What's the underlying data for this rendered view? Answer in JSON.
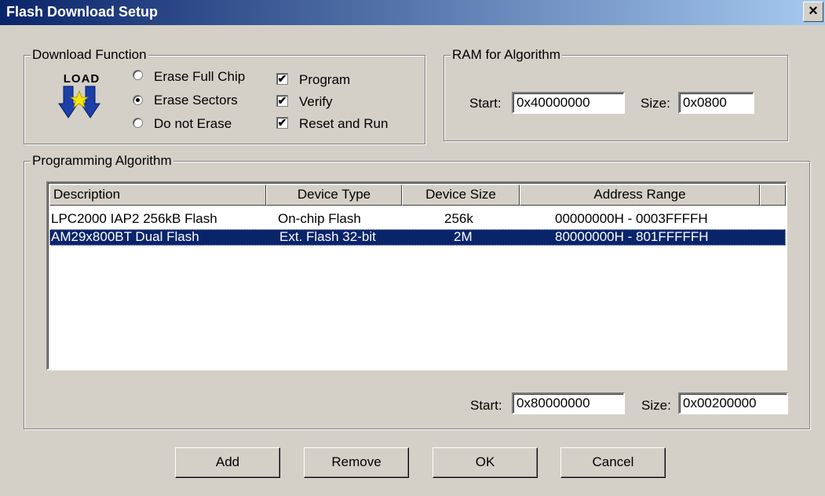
{
  "window": {
    "title": "Flash Download Setup",
    "close_glyph": "×"
  },
  "download_function": {
    "legend": "Download Function",
    "icon_text": "LOAD",
    "radios": [
      {
        "label": "Erase Full Chip",
        "selected": false
      },
      {
        "label": "Erase Sectors",
        "selected": true
      },
      {
        "label": "Do not Erase",
        "selected": false
      }
    ],
    "checks": [
      {
        "label": "Program",
        "checked": true,
        "mark": "✔"
      },
      {
        "label": "Verify",
        "checked": true,
        "mark": "✔"
      },
      {
        "label": "Reset and Run",
        "checked": true,
        "mark": "✔"
      }
    ]
  },
  "ram": {
    "legend": "RAM for Algorithm",
    "start_label": "Start:",
    "start_value": "0x40000000",
    "size_label": "Size:",
    "size_value": "0x0800"
  },
  "programming": {
    "legend": "Programming Algorithm",
    "columns": [
      "Description",
      "Device Type",
      "Device Size",
      "Address Range"
    ],
    "rows": [
      {
        "description": "LPC2000 IAP2 256kB Flash",
        "device_type": "On-chip Flash",
        "device_size": "256k",
        "address_range": "00000000H - 0003FFFFH",
        "selected": false
      },
      {
        "description": "AM29x800BT Dual Flash",
        "device_type": "Ext. Flash 32-bit",
        "device_size": "2M",
        "address_range": "80000000H - 801FFFFFH",
        "selected": true
      }
    ],
    "start_label": "Start:",
    "start_value": "0x80000000",
    "size_label": "Size:",
    "size_value": "0x00200000"
  },
  "buttons": {
    "add": "Add",
    "remove": "Remove",
    "ok": "OK",
    "cancel": "Cancel"
  },
  "colors": {
    "dialog_face": "#d4d0c8",
    "title_active": "#0a246a",
    "selection": "#0a246a",
    "icon_arrow": "#1c3fa8",
    "icon_star": "#f5e800"
  }
}
